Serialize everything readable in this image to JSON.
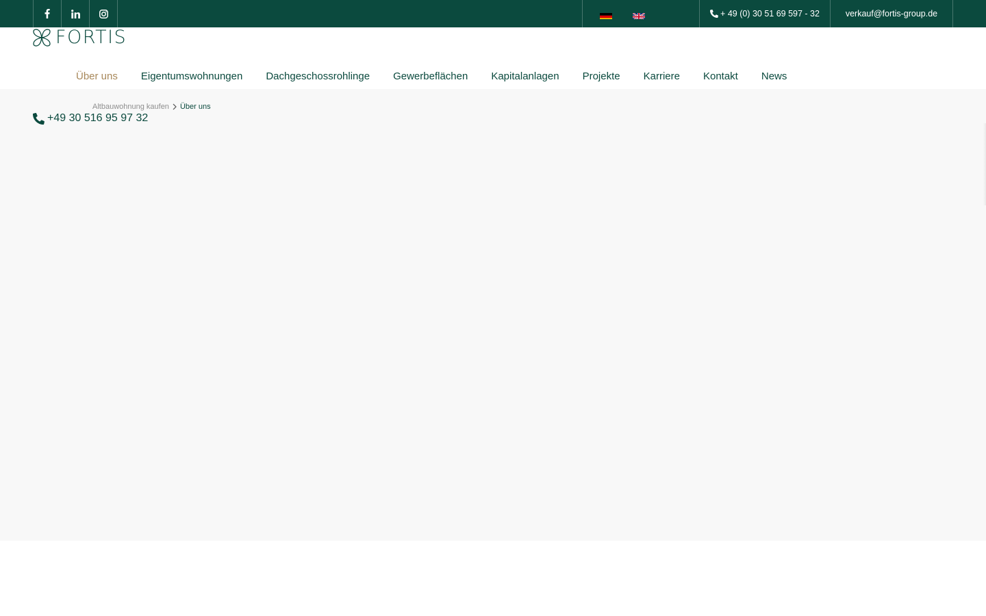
{
  "topbar": {
    "social": [
      {
        "name": "facebook-icon",
        "glyph": "f"
      },
      {
        "name": "linkedin-icon",
        "glyph": "in"
      },
      {
        "name": "instagram-icon",
        "glyph": ""
      }
    ],
    "languages": [
      "de",
      "en"
    ],
    "phone": "+ 49 (0) 30 51 69 597 - 32",
    "email": "verkauf@fortis-group.de"
  },
  "header": {
    "logo_text": "FORTIS",
    "nav": [
      {
        "label": "Über uns",
        "active": true
      },
      {
        "label": "Eigentumswohnungen",
        "active": false
      },
      {
        "label": "Dachgeschossrohlinge",
        "active": false
      },
      {
        "label": "Gewerbeflächen",
        "active": false
      },
      {
        "label": "Kapitalanlagen",
        "active": false
      },
      {
        "label": "Projekte",
        "active": false
      },
      {
        "label": "Karriere",
        "active": false
      },
      {
        "label": "Kontakt",
        "active": false
      },
      {
        "label": "News",
        "active": false
      }
    ]
  },
  "breadcrumb": {
    "parent": "Altbauwohnung kaufen",
    "current": "Über uns"
  },
  "hero": {
    "phone": "+49 30 516 95 97 32"
  },
  "colors": {
    "brand_green": "#0b4a3e",
    "accent_gold": "#a8885a",
    "content_bg": "#f8f8f8",
    "muted_text": "#8e8e8e"
  }
}
